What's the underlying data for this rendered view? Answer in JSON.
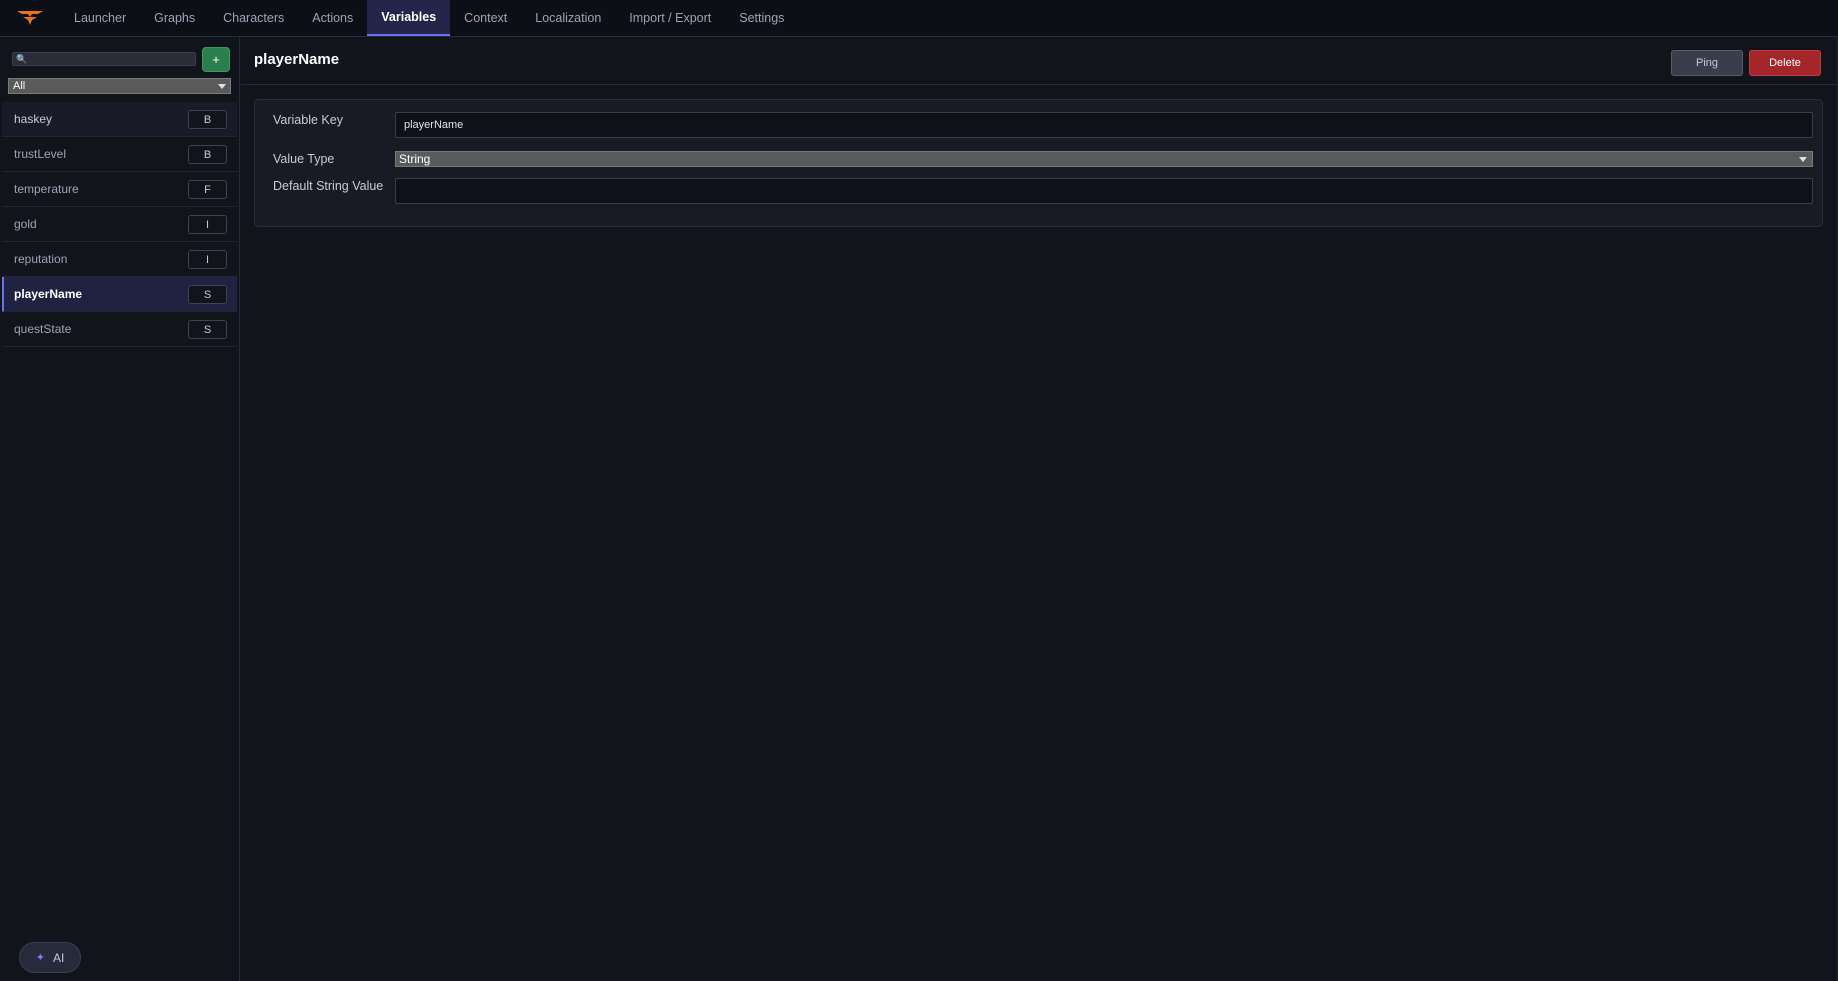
{
  "topbar": {
    "logo_icon": "bat-logo-icon",
    "tabs": [
      {
        "label": "Launcher",
        "active": false
      },
      {
        "label": "Graphs",
        "active": false
      },
      {
        "label": "Characters",
        "active": false
      },
      {
        "label": "Actions",
        "active": false
      },
      {
        "label": "Variables",
        "active": true
      },
      {
        "label": "Context",
        "active": false
      },
      {
        "label": "Localization",
        "active": false
      },
      {
        "label": "Import / Export",
        "active": false
      },
      {
        "label": "Settings",
        "active": false
      }
    ]
  },
  "sidebar": {
    "search": {
      "value": "",
      "placeholder": "",
      "icon": "search-icon"
    },
    "add_label": "+",
    "filter": {
      "selected": "All"
    },
    "variables": [
      {
        "name": "haskey",
        "type": "B"
      },
      {
        "name": "trustLevel",
        "type": "B"
      },
      {
        "name": "temperature",
        "type": "F"
      },
      {
        "name": "gold",
        "type": "I"
      },
      {
        "name": "reputation",
        "type": "I"
      },
      {
        "name": "playerName",
        "type": "S"
      },
      {
        "name": "questState",
        "type": "S"
      }
    ],
    "selected_index": 5,
    "ai_button": {
      "label": "AI",
      "icon": "sparkle-icon"
    }
  },
  "main": {
    "title": "playerName",
    "ping_label": "Ping",
    "delete_label": "Delete",
    "fields": {
      "key_label": "Variable Key",
      "key_value": "playerName",
      "type_label": "Value Type",
      "type_value": "String",
      "default_label": "Default String Value",
      "default_value": ""
    }
  },
  "colors": {
    "accent": "#6b6ff0",
    "add_green": "#2b7f4c",
    "delete_red": "#a3262a",
    "logo_orange": "#e8731c"
  }
}
